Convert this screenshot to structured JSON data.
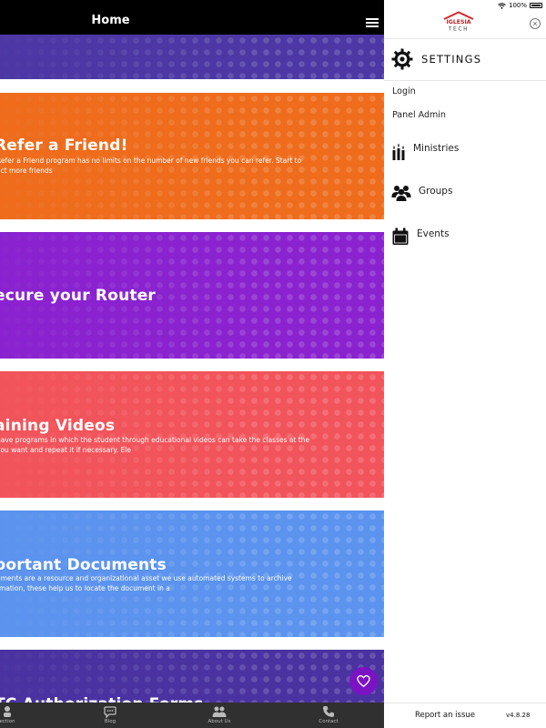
{
  "header": {
    "title": "Home"
  },
  "cards": [
    {
      "title": "",
      "description": "",
      "color": "#4c37a4"
    },
    {
      "title": "Refer a Friend!",
      "description": "Refer a Friend program has no limits on the number of new friends you can refer. Start to act more friends",
      "color": "#ee6c1c"
    },
    {
      "title": "ecure your Router",
      "description": "",
      "color": "#8a23cf"
    },
    {
      "title": "aining Videos",
      "description": "have programs in which the student through educational videos can take the classes at the you want and repeat it if necessary. Ele",
      "color": "#f2545b"
    },
    {
      "title": "portant Documents",
      "description": "uments are a resource and organizational asset we use automated systems to archive rmation, these help us to locate the document in a",
      "color": "#5b93ee"
    },
    {
      "title": "TC Authorization Forms",
      "description": "",
      "color": "#4a33a0"
    }
  ],
  "bottom_nav": [
    {
      "label": "ection",
      "icon": "connection-icon"
    },
    {
      "label": "Blog",
      "icon": "chat-bubble-icon"
    },
    {
      "label": "About Us",
      "icon": "people-icon"
    },
    {
      "label": "Contact",
      "icon": "phone-icon"
    }
  ],
  "status_bar": {
    "battery": "100%"
  },
  "drawer": {
    "logo_text_top": "IGLESIA",
    "logo_text_bottom": "TECH",
    "settings_label": "SETTINGS",
    "login_label": "Login",
    "panel_admin_label": "Panel Admin",
    "menu": [
      {
        "label": "Ministries",
        "icon": "ministries-icon"
      },
      {
        "label": "Groups",
        "icon": "groups-icon"
      },
      {
        "label": "Events",
        "icon": "calendar-icon"
      }
    ],
    "report_label": "Report an issue",
    "version": "v4.8.28"
  },
  "colors": {
    "topbar": "#000000",
    "bottombar": "#303030",
    "fab": "#7b12c4",
    "logo_red": "#d32a2a"
  }
}
